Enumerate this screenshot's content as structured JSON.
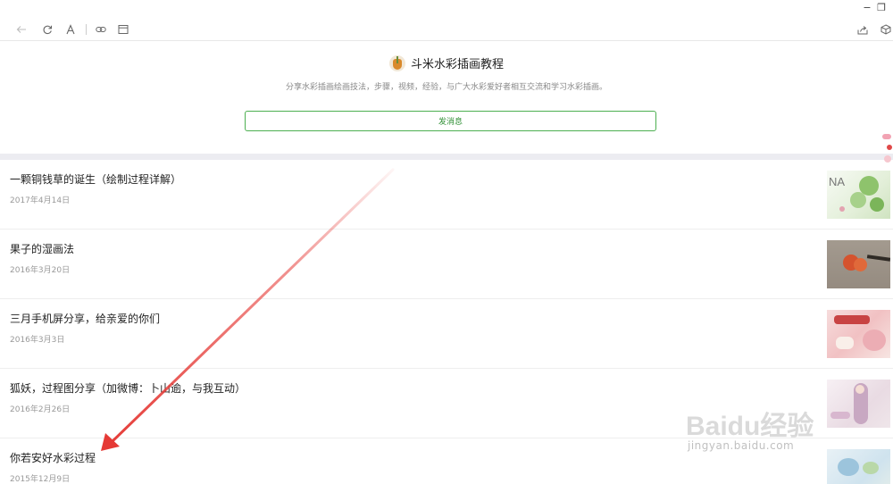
{
  "window": {
    "minimize_glyph": "−",
    "maximize_glyph": "❐"
  },
  "toolbar": {
    "icons": [
      "back-icon",
      "refresh-icon",
      "font-size-icon",
      "copy-link-icon",
      "open-browser-icon",
      "share-icon",
      "cube-icon"
    ]
  },
  "account": {
    "name": "斗米水彩插画教程",
    "description": "分享水彩插画绘画技法，步骤，视频，经验，与广大水彩爱好者相互交流和学习水彩插画。",
    "message_button": "发消息",
    "accent_color": "#4caf50"
  },
  "articles": [
    {
      "title": "一颗铜钱草的诞生（绘制过程详解）",
      "date": "2017年4月14日",
      "thumb_text": "NA"
    },
    {
      "title": "果子的湿画法",
      "date": "2016年3月20日"
    },
    {
      "title": "三月手机屏分享，给亲爱的你们",
      "date": "2016年3月3日"
    },
    {
      "title": "狐妖，过程图分享（加微博：卜山逾，与我互动）",
      "date": "2016年2月26日"
    },
    {
      "title": "你若安好水彩过程",
      "date": "2015年12月9日"
    }
  ],
  "watermark": {
    "brand": "Baidu经验",
    "url": "jingyan.baidu.com"
  },
  "annotation": {
    "arrow_color": "#e53935"
  }
}
